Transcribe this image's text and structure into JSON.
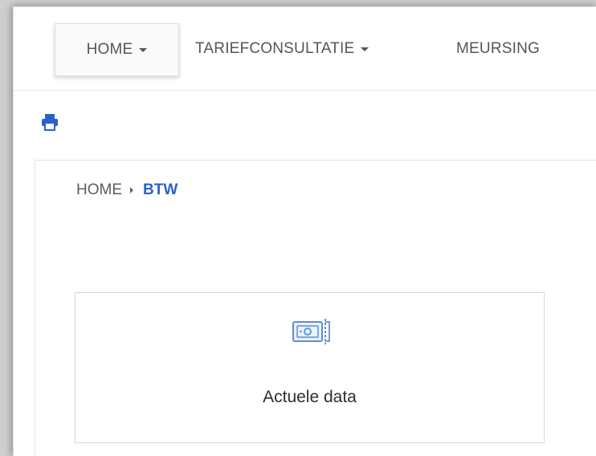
{
  "nav": {
    "home_label": "HOME",
    "tarief_label": "TARIEFCONSULTATIE",
    "meursing_label": "MEURSING"
  },
  "toolbar": {
    "print_icon": "print-icon"
  },
  "breadcrumb": {
    "home": "HOME",
    "current": "BTW"
  },
  "tile": {
    "icon": "banknote-icon",
    "label": "Actuele data"
  },
  "colors": {
    "accent": "#2a62c9",
    "icon_blue": "#5b8fd6",
    "text": "#555555"
  }
}
